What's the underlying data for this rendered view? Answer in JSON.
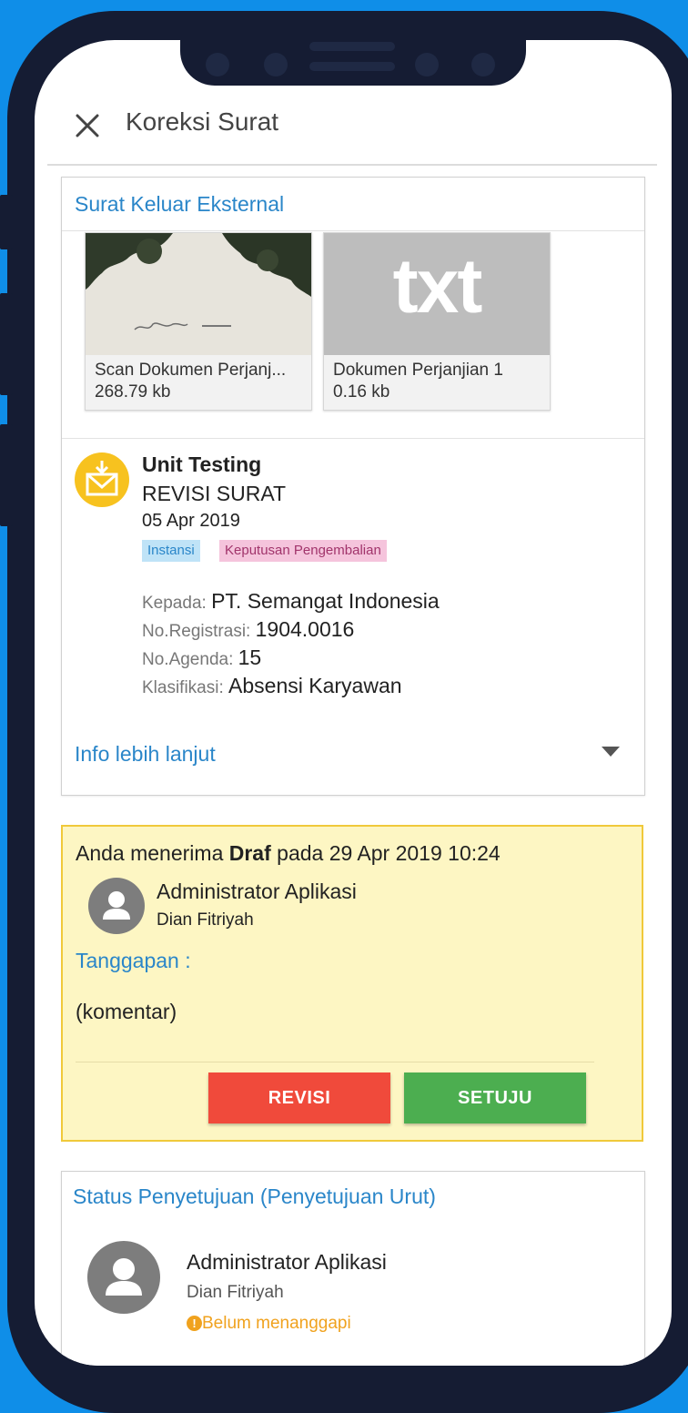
{
  "header": {
    "title": "Koreksi Surat"
  },
  "letter_card": {
    "section_title": "Surat Keluar Eksternal",
    "attachments": [
      {
        "name": "Scan Dokumen Perjanj...",
        "size": "268.79 kb",
        "preview": "photo"
      },
      {
        "name": "Dokumen Perjanjian 1",
        "size": "0.16 kb",
        "preview": "txt"
      }
    ],
    "txt_badge": "txt",
    "sender": "Unit Testing",
    "subject": "REVISI SURAT",
    "date": "05 Apr 2019",
    "tags": [
      {
        "label": "Instansi",
        "color": "#bfe3f7",
        "text_color": "#2a86c9"
      },
      {
        "label": "Keputusan Pengembalian",
        "color": "#f5c4dc",
        "text_color": "#a1346b"
      }
    ],
    "details": [
      {
        "label": "Kepada:",
        "value": "PT. Semangat Indonesia"
      },
      {
        "label": "No.Registrasi:",
        "value": "1904.0016"
      },
      {
        "label": "No.Agenda:",
        "value": "15"
      },
      {
        "label": "Klasifikasi:",
        "value": "Absensi Karyawan"
      }
    ],
    "more_info": "Info lebih lanjut",
    "icon": "envelope-download-icon"
  },
  "draft_card": {
    "text_before": "Anda menerima",
    "text_bold": "Draf",
    "text_after": "pada 29 Apr 2019 10:24",
    "user_name": "Administrator Aplikasi",
    "user_sub": "Dian Fitriyah",
    "response_label": "Tanggapan :",
    "comment": "(komentar)",
    "btn_revisi": "REVISI",
    "btn_setuju": "SETUJU",
    "colors": {
      "background": "#fdf6c3",
      "border": "#f0c93a",
      "revisi": "#f04a3b",
      "setuju": "#4cae50"
    }
  },
  "status_card": {
    "title": "Status Penyetujuan (Penyetujuan Urut)",
    "user_name": "Administrator Aplikasi",
    "user_sub": "Dian Fitriyah",
    "status": "Belum menanggapi",
    "status_color": "#f0a21e"
  },
  "colors": {
    "accent": "#2a86c9",
    "frame": "#151c33",
    "background": "#0f8ee8",
    "mail_icon": "#f7c21f"
  }
}
